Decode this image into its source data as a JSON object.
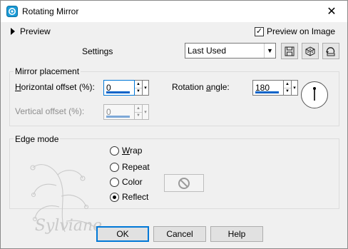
{
  "window": {
    "title": "Rotating Mirror",
    "close_glyph": "✕"
  },
  "preview": {
    "label": "Preview",
    "on_image_label": "Preview on Image",
    "on_image_checked": true
  },
  "settings": {
    "label": "Settings",
    "preset_value": "Last Used",
    "icons": [
      "save-preset-icon",
      "randomize-icon",
      "reset-icon"
    ]
  },
  "mirror_placement": {
    "title": "Mirror placement",
    "horizontal": {
      "label_pre": "H",
      "label_rest": "orizontal offset (%):",
      "value": "0"
    },
    "vertical": {
      "label": "Vertical offset (%):",
      "value": "0",
      "disabled": true
    },
    "rotation": {
      "label_pre": "Rotation ",
      "label_u": "a",
      "label_rest": "ngle:",
      "value": "180"
    }
  },
  "edge_mode": {
    "title": "Edge mode",
    "options": [
      {
        "u": "W",
        "rest": "rap",
        "selected": false
      },
      {
        "u": "",
        "rest": "Repeat",
        "selected": false
      },
      {
        "u": "",
        "rest": "Color",
        "selected": false
      },
      {
        "u": "",
        "rest": "Reflect",
        "selected": true
      }
    ]
  },
  "buttons": {
    "ok": "OK",
    "cancel": "Cancel",
    "help": "Help"
  },
  "watermark": {
    "text": "Sylviane"
  },
  "colors": {
    "accent": "#0078d7",
    "field_bar": "#0a64c8",
    "dialog_bg": "#f0f0f0"
  }
}
